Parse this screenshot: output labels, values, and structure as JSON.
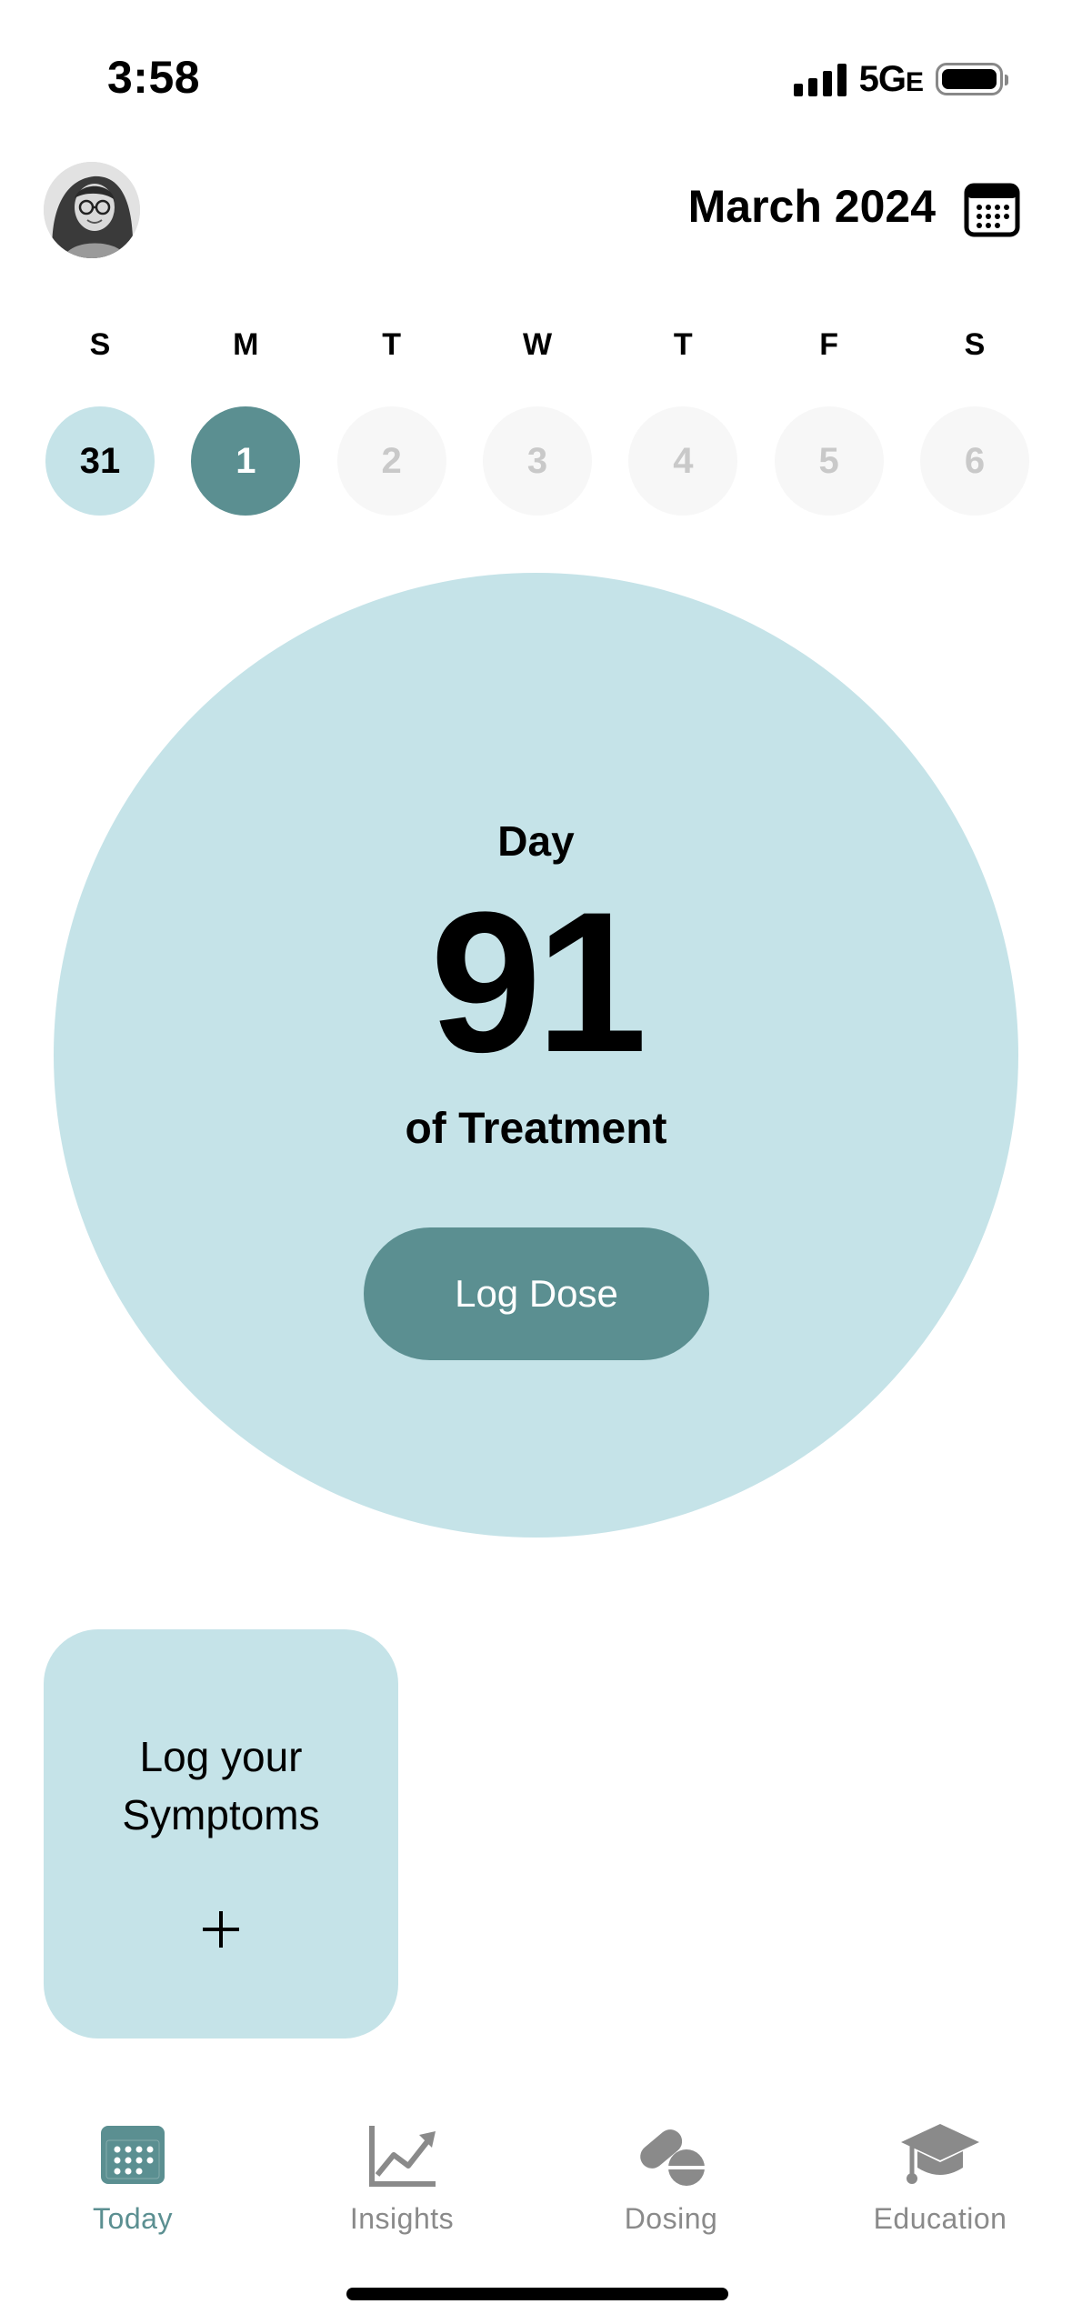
{
  "status_bar": {
    "time": "3:58",
    "network": "5G",
    "network_suffix": "E"
  },
  "header": {
    "month": "March 2024",
    "calendar_icon": "calendar-icon",
    "avatar_icon": "user-avatar"
  },
  "week": {
    "labels": [
      "S",
      "M",
      "T",
      "W",
      "T",
      "F",
      "S"
    ],
    "days": [
      "31",
      "1",
      "2",
      "3",
      "4",
      "5",
      "6"
    ],
    "past_index": 0,
    "selected_index": 1
  },
  "hero": {
    "day_label": "Day",
    "day_number": "91",
    "subtitle": "of Treatment",
    "button_label": "Log Dose"
  },
  "symptoms": {
    "label_line1": "Log your",
    "label_line2": "Symptoms",
    "icon": "plus-icon"
  },
  "tabs": [
    {
      "label": "Today",
      "icon": "calendar-icon",
      "active": true
    },
    {
      "label": "Insights",
      "icon": "chart-icon",
      "active": false
    },
    {
      "label": "Dosing",
      "icon": "pills-icon",
      "active": false
    },
    {
      "label": "Education",
      "icon": "graduation-cap-icon",
      "active": false
    }
  ],
  "colors": {
    "accent": "#5b8f91",
    "light_accent": "#c5e3e8",
    "inactive": "#8a8a8a"
  }
}
